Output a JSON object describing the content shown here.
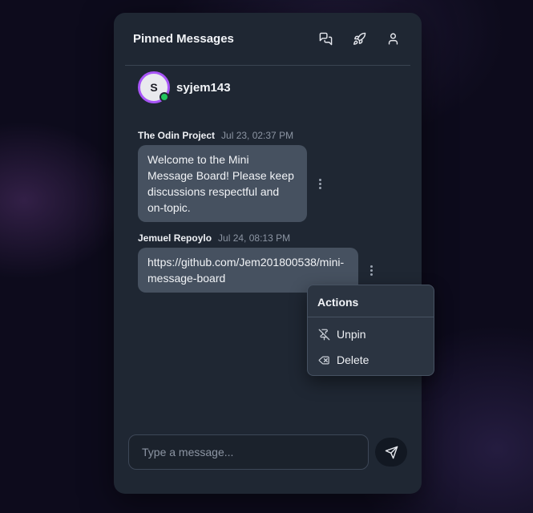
{
  "header": {
    "title": "Pinned Messages",
    "icons": [
      "messages-icon",
      "rocket-icon",
      "user-icon"
    ]
  },
  "user": {
    "avatar_initial": "S",
    "username": "syjem143",
    "status": "online",
    "avatar_ring_color": "#a855f7",
    "status_color": "#22c55e"
  },
  "messages": [
    {
      "author": "The Odin Project",
      "time": "Jul 23, 02:37 PM",
      "text": "Welcome to the Mini Message Board! Please keep discussions respectful and on-topic."
    },
    {
      "author": "Jemuel Repoylo",
      "time": "Jul 24, 08:13 PM",
      "text": "https://github.com/Jem201800538/mini-message-board"
    }
  ],
  "actions_menu": {
    "title": "Actions",
    "items": [
      {
        "label": "Unpin",
        "icon": "pin-off-icon"
      },
      {
        "label": "Delete",
        "icon": "delete-icon"
      }
    ]
  },
  "composer": {
    "placeholder": "Type a message...",
    "value": "",
    "send_icon": "send-icon"
  }
}
